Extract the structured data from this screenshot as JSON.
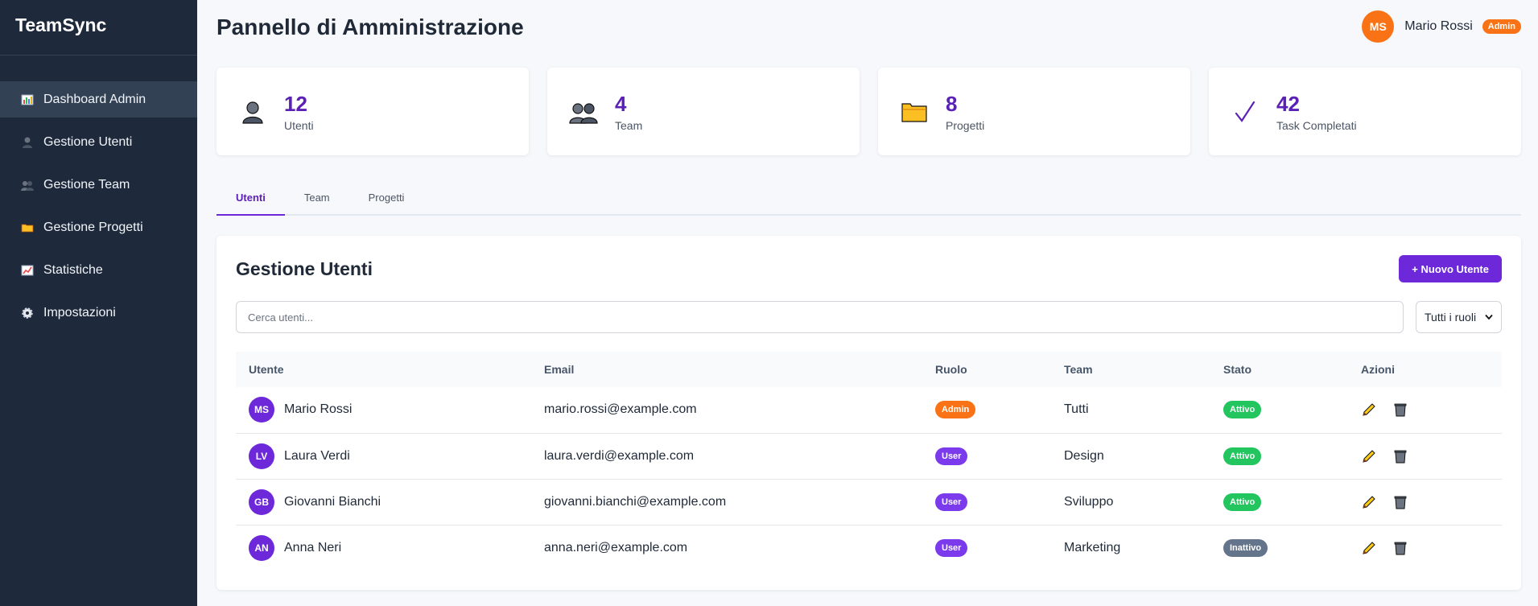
{
  "app": {
    "brand": "TeamSync"
  },
  "sidebar": {
    "items": [
      {
        "label": "Dashboard Admin",
        "icon": "bar-chart-icon",
        "active": true
      },
      {
        "label": "Gestione Utenti",
        "icon": "user-icon"
      },
      {
        "label": "Gestione Team",
        "icon": "users-icon"
      },
      {
        "label": "Gestione Progetti",
        "icon": "folder-icon"
      },
      {
        "label": "Statistiche",
        "icon": "line-chart-icon"
      },
      {
        "label": "Impostazioni",
        "icon": "gear-icon"
      }
    ]
  },
  "header": {
    "title": "Pannello di Amministrazione",
    "user": {
      "initials": "MS",
      "name": "Mario Rossi",
      "role_badge": "Admin"
    }
  },
  "stats": [
    {
      "value": "12",
      "label": "Utenti",
      "icon": "user-icon"
    },
    {
      "value": "4",
      "label": "Team",
      "icon": "users-icon"
    },
    {
      "value": "8",
      "label": "Progetti",
      "icon": "folder-icon"
    },
    {
      "value": "42",
      "label": "Task Completati",
      "icon": "check-icon"
    }
  ],
  "tabs": [
    {
      "label": "Utenti",
      "active": true
    },
    {
      "label": "Team"
    },
    {
      "label": "Progetti"
    }
  ],
  "panel": {
    "title": "Gestione Utenti",
    "new_button": "+ Nuovo Utente",
    "search_placeholder": "Cerca utenti...",
    "role_filter": "Tutti i ruoli"
  },
  "table": {
    "headers": [
      "Utente",
      "Email",
      "Ruolo",
      "Team",
      "Stato",
      "Azioni"
    ],
    "rows": [
      {
        "initials": "MS",
        "name": "Mario Rossi",
        "email": "mario.rossi@example.com",
        "role": "Admin",
        "team": "Tutti",
        "status": "Attivo"
      },
      {
        "initials": "LV",
        "name": "Laura Verdi",
        "email": "laura.verdi@example.com",
        "role": "User",
        "team": "Design",
        "status": "Attivo"
      },
      {
        "initials": "GB",
        "name": "Giovanni Bianchi",
        "email": "giovanni.bianchi@example.com",
        "role": "User",
        "team": "Sviluppo",
        "status": "Attivo"
      },
      {
        "initials": "AN",
        "name": "Anna Neri",
        "email": "anna.neri@example.com",
        "role": "User",
        "team": "Marketing",
        "status": "Inattivo"
      }
    ]
  },
  "colors": {
    "sidebar_bg": "#1e293b",
    "accent": "#6d28d9",
    "admin_badge": "#f97316",
    "active_badge": "#22c55e",
    "inactive_badge": "#64748b"
  }
}
